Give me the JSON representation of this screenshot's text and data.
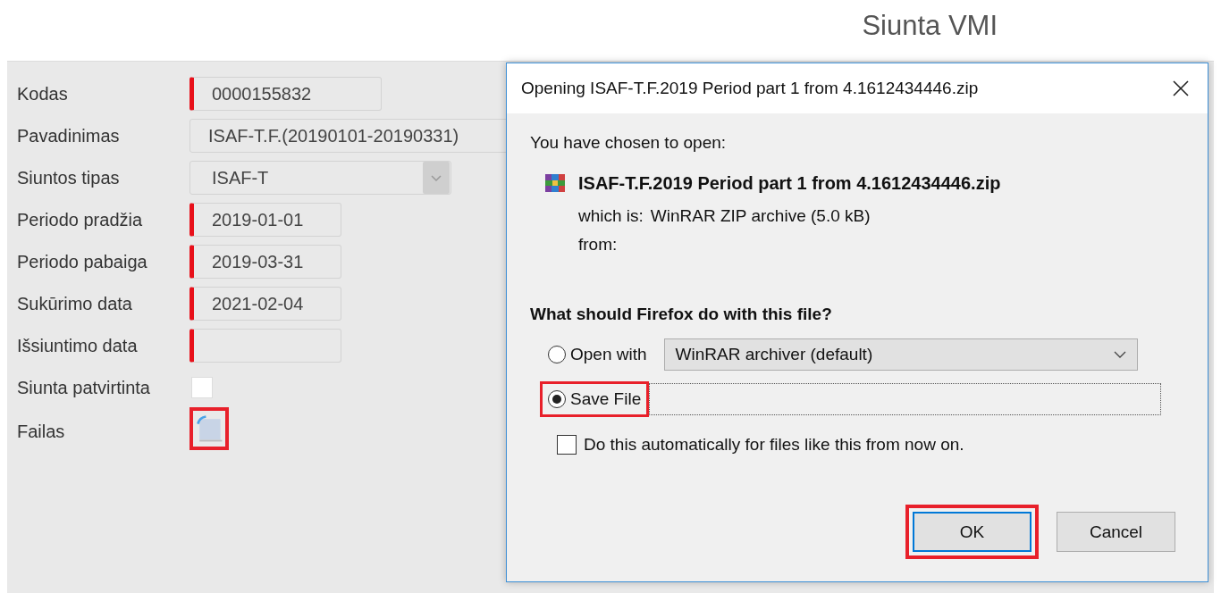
{
  "page": {
    "title": "Siunta VMI"
  },
  "form": [
    {
      "label": "Kodas",
      "kind": "text",
      "value": "0000155832",
      "required": true
    },
    {
      "label": "Pavadinimas",
      "kind": "text",
      "value": "ISAF-T.F.(20190101-20190331)",
      "required": false
    },
    {
      "label": "Siuntos tipas",
      "kind": "select",
      "value": "ISAF-T",
      "required": false
    },
    {
      "label": "Periodo pradžia",
      "kind": "text",
      "value": "2019-01-01",
      "required": true
    },
    {
      "label": "Periodo pabaiga",
      "kind": "text",
      "value": "2019-03-31",
      "required": true
    },
    {
      "label": "Sukūrimo data",
      "kind": "text",
      "value": "2021-02-04",
      "required": true
    },
    {
      "label": "Išsiuntimo data",
      "kind": "text",
      "required": true
    },
    {
      "label": "Siunta patvirtinta",
      "kind": "checkbox",
      "checked": false
    },
    {
      "label": "Failas",
      "kind": "file",
      "highlighted": true
    }
  ],
  "dialog": {
    "title": "Opening ISAF-T.F.2019 Period part 1 from 4.1612434446.zip",
    "intro": "You have chosen to open:",
    "filename": "ISAF-T.F.2019 Period part 1 from 4.1612434446.zip",
    "type_label": "which is:",
    "type_value": "WinRAR ZIP archive (5.0 kB)",
    "from_label": "from:",
    "question": "What should Firefox do with this file?",
    "options": [
      {
        "label": "Open with",
        "selected": false,
        "highlighted": false,
        "app": "WinRAR archiver (default)"
      },
      {
        "label": "Save File",
        "selected": true,
        "highlighted": true
      }
    ],
    "auto": {
      "label": "Do this automatically for files like this from now on.",
      "checked": false
    },
    "buttons": [
      {
        "label": "OK",
        "focused": true,
        "highlighted": true
      },
      {
        "label": "Cancel",
        "focused": false,
        "highlighted": false
      }
    ]
  }
}
